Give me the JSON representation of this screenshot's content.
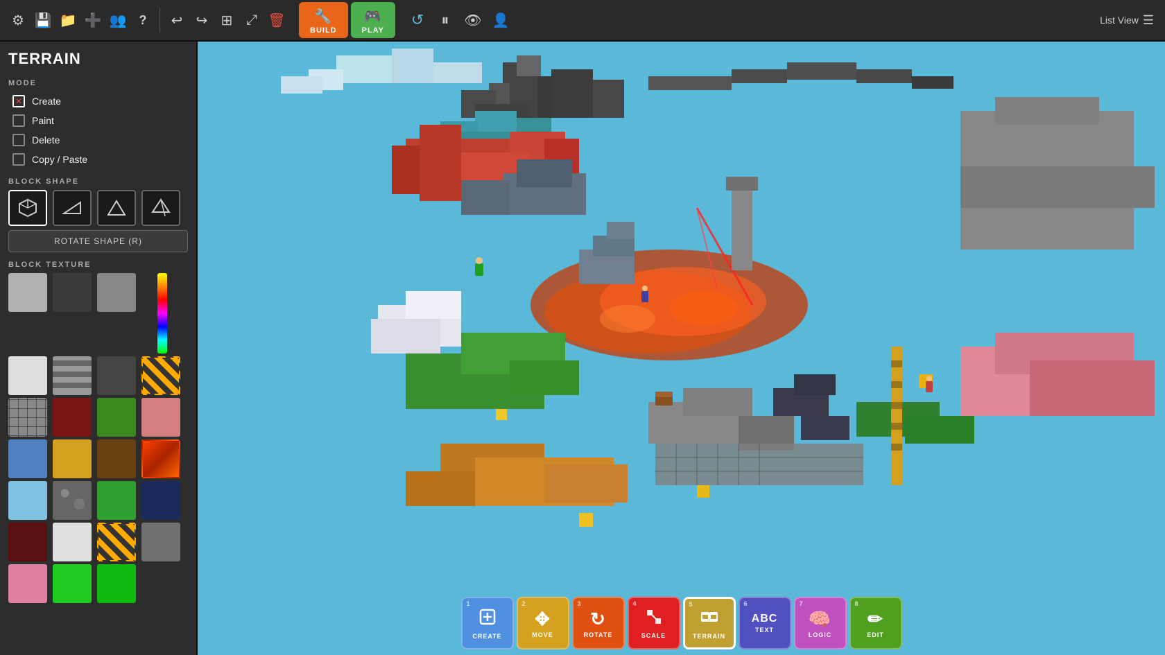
{
  "header": {
    "title": "TERRAIN",
    "build_label": "BUILD",
    "play_label": "PLAY",
    "list_view_label": "List View"
  },
  "toolbar": {
    "icons": [
      {
        "name": "settings-icon",
        "symbol": "⚙"
      },
      {
        "name": "save-icon",
        "symbol": "💾"
      },
      {
        "name": "folder-icon",
        "symbol": "📁"
      },
      {
        "name": "add-icon",
        "symbol": "➕"
      },
      {
        "name": "users-icon",
        "symbol": "👥"
      },
      {
        "name": "help-icon",
        "symbol": "?"
      },
      {
        "name": "undo-icon",
        "symbol": "↩"
      },
      {
        "name": "redo-icon",
        "symbol": "↪"
      },
      {
        "name": "copy-layout-icon",
        "symbol": "⊞"
      },
      {
        "name": "expand-icon",
        "symbol": "⤢"
      },
      {
        "name": "delete-icon",
        "symbol": "🗑"
      }
    ]
  },
  "play_toolbar": {
    "refresh_icon": "↺",
    "pause_icon": "⏸",
    "eye_icon": "👁",
    "person_icon": "👤"
  },
  "sidebar": {
    "title": "TERRAIN",
    "mode": {
      "label": "MODE",
      "items": [
        {
          "id": "create",
          "label": "Create",
          "active": true,
          "checked": true
        },
        {
          "id": "paint",
          "label": "Paint",
          "active": false,
          "checked": false
        },
        {
          "id": "delete",
          "label": "Delete",
          "active": false,
          "checked": false
        },
        {
          "id": "copy-paste",
          "label": "Copy / Paste",
          "active": false,
          "checked": false
        }
      ]
    },
    "block_shape": {
      "label": "BLOCK SHAPE",
      "shapes": [
        {
          "id": "cube",
          "symbol": "⬡"
        },
        {
          "id": "slope",
          "symbol": "◪"
        },
        {
          "id": "wedge",
          "symbol": "△"
        },
        {
          "id": "pyramid",
          "symbol": "▲"
        }
      ],
      "rotate_label": "ROTATE SHAPE (R)"
    },
    "block_texture": {
      "label": "BLOCK TEXTURE",
      "textures": [
        {
          "id": "tex-light-gray",
          "class": "tex-light-gray"
        },
        {
          "id": "tex-dark-gray",
          "class": "tex-dark-gray"
        },
        {
          "id": "tex-gray-brick",
          "class": "tex-gray-brick"
        },
        {
          "id": "tex-yellow-stripe",
          "class": "tex-yellow-stripe"
        },
        {
          "id": "tex-white-stripe",
          "class": "tex-white-stripe"
        },
        {
          "id": "tex-striped",
          "class": "tex-striped"
        },
        {
          "id": "tex-dark2",
          "class": "tex-dark2"
        },
        {
          "id": "tex-red-brick",
          "class": "tex-red-brick"
        },
        {
          "id": "tex-hazard",
          "class": "tex-hazard"
        },
        {
          "id": "tex-tile",
          "class": "tex-tile"
        },
        {
          "id": "tex-dark-red",
          "class": "tex-dark-red"
        },
        {
          "id": "tex-green",
          "class": "tex-green"
        },
        {
          "id": "tex-pink-brick",
          "class": "tex-pink-brick"
        },
        {
          "id": "tex-blue-cracked",
          "class": "tex-blue-cracked"
        },
        {
          "id": "tex-gold",
          "class": "tex-gold"
        },
        {
          "id": "tex-dirt",
          "class": "tex-dirt"
        },
        {
          "id": "tex-lava",
          "class": "tex-lava"
        },
        {
          "id": "tex-ice",
          "class": "tex-ice"
        },
        {
          "id": "tex-cobble",
          "class": "tex-cobble"
        },
        {
          "id": "tex-green2",
          "class": "tex-green2"
        },
        {
          "id": "tex-dark-blue",
          "class": "tex-dark-blue"
        },
        {
          "id": "tex-dark-red2",
          "class": "tex-dark-red2"
        },
        {
          "id": "tex-white",
          "class": "tex-white"
        },
        {
          "id": "tex-hazard2",
          "class": "tex-hazard2"
        },
        {
          "id": "tex-stone2",
          "class": "tex-stone2"
        },
        {
          "id": "tex-pink",
          "class": "tex-pink"
        },
        {
          "id": "tex-bright-green",
          "class": "tex-bright-green"
        },
        {
          "id": "tex-bright-green2",
          "class": "tex-bright-green2"
        }
      ]
    }
  },
  "bottom_tools": [
    {
      "num": "1",
      "label": "CREATE",
      "class": "tool-create",
      "icon": "⊞",
      "name": "create-tool"
    },
    {
      "num": "2",
      "label": "MOVE",
      "class": "tool-move",
      "icon": "✥",
      "name": "move-tool"
    },
    {
      "num": "3",
      "label": "ROTATE",
      "class": "tool-rotate",
      "icon": "↻",
      "name": "rotate-tool"
    },
    {
      "num": "4",
      "label": "SCALE",
      "class": "tool-scale",
      "icon": "⤡",
      "name": "scale-tool"
    },
    {
      "num": "5",
      "label": "TERRAIN",
      "class": "tool-terrain",
      "icon": "⊞",
      "name": "terrain-tool"
    },
    {
      "num": "6",
      "label": "TEXT",
      "class": "tool-text",
      "icon": "ABC",
      "name": "text-tool"
    },
    {
      "num": "7",
      "label": "LOGIC",
      "class": "tool-logic",
      "icon": "🧠",
      "name": "logic-tool"
    },
    {
      "num": "8",
      "label": "EDIT",
      "class": "tool-edit",
      "icon": "✏",
      "name": "edit-tool"
    }
  ]
}
